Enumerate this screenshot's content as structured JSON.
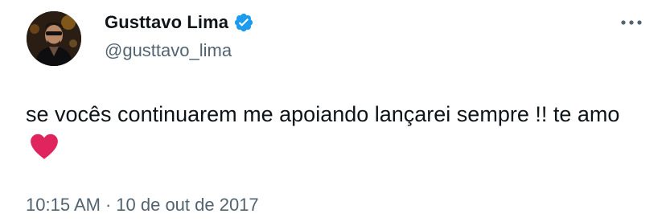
{
  "author": {
    "display_name": "Gusttavo Lima",
    "handle": "@gusttavo_lima",
    "verified": true,
    "avatar_icon": "profile-photo"
  },
  "tweet": {
    "text": "se vocês continuarem me apoiando lançarei sempre !! te amo",
    "emoji": "red-heart",
    "time": "10:15 AM",
    "separator": "·",
    "date": "10 de out de 2017"
  },
  "icons": {
    "verified_color": "#1d9bf0",
    "heart_color": "#e0245e",
    "more_icon": "more-horizontal-icon"
  }
}
